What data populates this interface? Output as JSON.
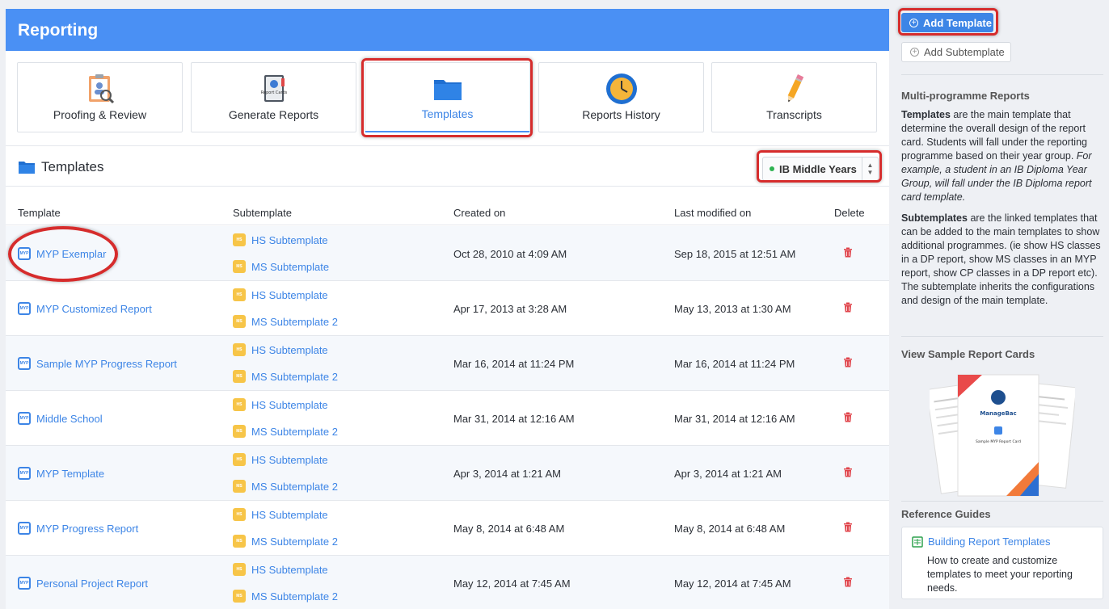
{
  "header": {
    "title": "Reporting"
  },
  "tiles": [
    {
      "label": "Proofing & Review",
      "icon": "proofing-review-icon"
    },
    {
      "label": "Generate Reports",
      "icon": "report-cards-book-icon",
      "icon_text": "Report Cards"
    },
    {
      "label": "Templates",
      "icon": "folder-icon",
      "active": true
    },
    {
      "label": "Reports History",
      "icon": "clock-icon"
    },
    {
      "label": "Transcripts",
      "icon": "pencil-icon"
    }
  ],
  "section": {
    "title": "Templates",
    "programme": "IB Middle Years"
  },
  "table": {
    "columns": [
      "Template",
      "Subtemplate",
      "Created on",
      "Last modified on",
      "Delete"
    ],
    "badges": {
      "template": "MYP",
      "hs": "HS",
      "ms": "MS"
    },
    "rows": [
      {
        "template": "MYP Exemplar",
        "sub1": "HS Subtemplate",
        "sub2": "MS Subtemplate",
        "created": "Oct 28, 2010 at 4:09 AM",
        "modified": "Sep 18, 2015 at 12:51 AM"
      },
      {
        "template": "MYP Customized Report",
        "sub1": "HS Subtemplate",
        "sub2": "MS Subtemplate 2",
        "created": "Apr 17, 2013 at 3:28 AM",
        "modified": "May 13, 2013 at 1:30 AM"
      },
      {
        "template": "Sample MYP Progress Report",
        "sub1": "HS Subtemplate",
        "sub2": "MS Subtemplate 2",
        "created": "Mar 16, 2014 at 11:24 PM",
        "modified": "Mar 16, 2014 at 11:24 PM"
      },
      {
        "template": "Middle School",
        "sub1": "HS Subtemplate",
        "sub2": "MS Subtemplate 2",
        "created": "Mar 31, 2014 at 12:16 AM",
        "modified": "Mar 31, 2014 at 12:16 AM"
      },
      {
        "template": "MYP Template",
        "sub1": "HS Subtemplate",
        "sub2": "MS Subtemplate 2",
        "created": "Apr 3, 2014 at 1:21 AM",
        "modified": "Apr 3, 2014 at 1:21 AM"
      },
      {
        "template": "MYP Progress Report",
        "sub1": "HS Subtemplate",
        "sub2": "MS Subtemplate 2",
        "created": "May 8, 2014 at 6:48 AM",
        "modified": "May 8, 2014 at 6:48 AM"
      },
      {
        "template": "Personal Project Report",
        "sub1": "HS Subtemplate",
        "sub2": "MS Subtemplate 2",
        "created": "May 12, 2014 at 7:45 AM",
        "modified": "May 12, 2014 at 7:45 AM"
      }
    ]
  },
  "sidebar": {
    "add_template": "Add Template",
    "add_subtemplate": "Add Subtemplate",
    "multi_heading": "Multi-programme Reports",
    "templates_bold": "Templates",
    "templates_text": " are the main template that determine the overall design of the report card. Students will fall under the reporting programme based on their year group. ",
    "templates_italic": "For example, a student in an IB Diploma Year Group, will fall under the IB Diploma report card template.",
    "subtemplates_bold": "Subtemplates",
    "subtemplates_text": " are the linked templates that can be added to the main templates to show additional programmes. (ie show HS classes in a DP report, show MS classes in an MYP report, show CP classes in a DP report etc). The subtemplate inherits the configurations and design of the main template.",
    "sample_heading": "View Sample Report Cards",
    "sample_brand": "ManageBac",
    "sample_caption": "Sample MYP Report Card",
    "guides_heading": "Reference Guides",
    "guide_link": "Building Report Templates",
    "guide_desc": "How to create and customize templates to meet your reporting needs."
  },
  "colors": {
    "header_blue": "#4a90f4",
    "link_blue": "#3d85e6",
    "highlight_red": "#d62c2c",
    "delete_red": "#e0434a",
    "subtemplate_badge": "#f7c548",
    "status_green": "#2fb352"
  }
}
